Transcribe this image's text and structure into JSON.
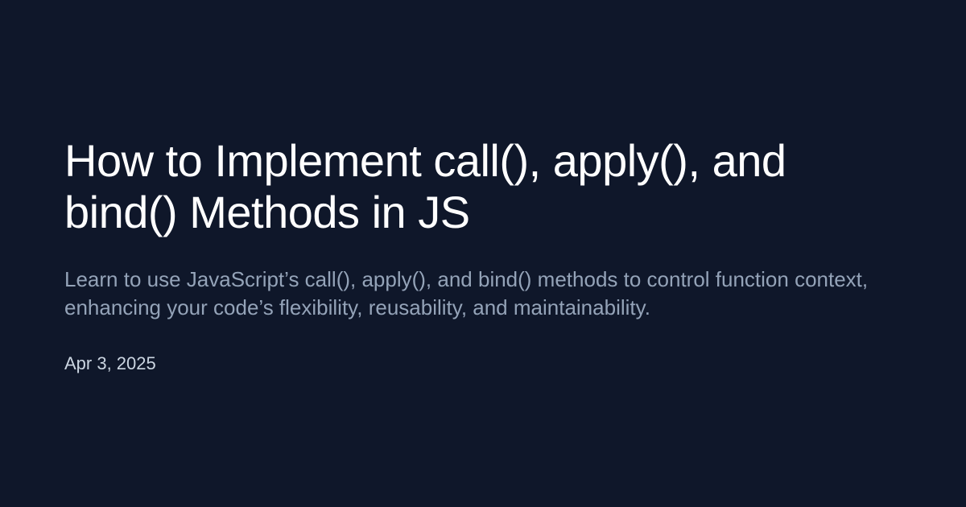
{
  "article": {
    "title": "How to Implement call(), apply(), and bind() Methods in JS",
    "description": "Learn to use JavaScript’s call(), apply(), and bind() methods to control function context, enhancing your code’s flexibility, reusability, and maintainability.",
    "date": "Apr 3, 2025"
  },
  "colors": {
    "background": "#0f172a",
    "title": "#ffffff",
    "description": "#94a3b8",
    "date": "#cbd5e1"
  }
}
